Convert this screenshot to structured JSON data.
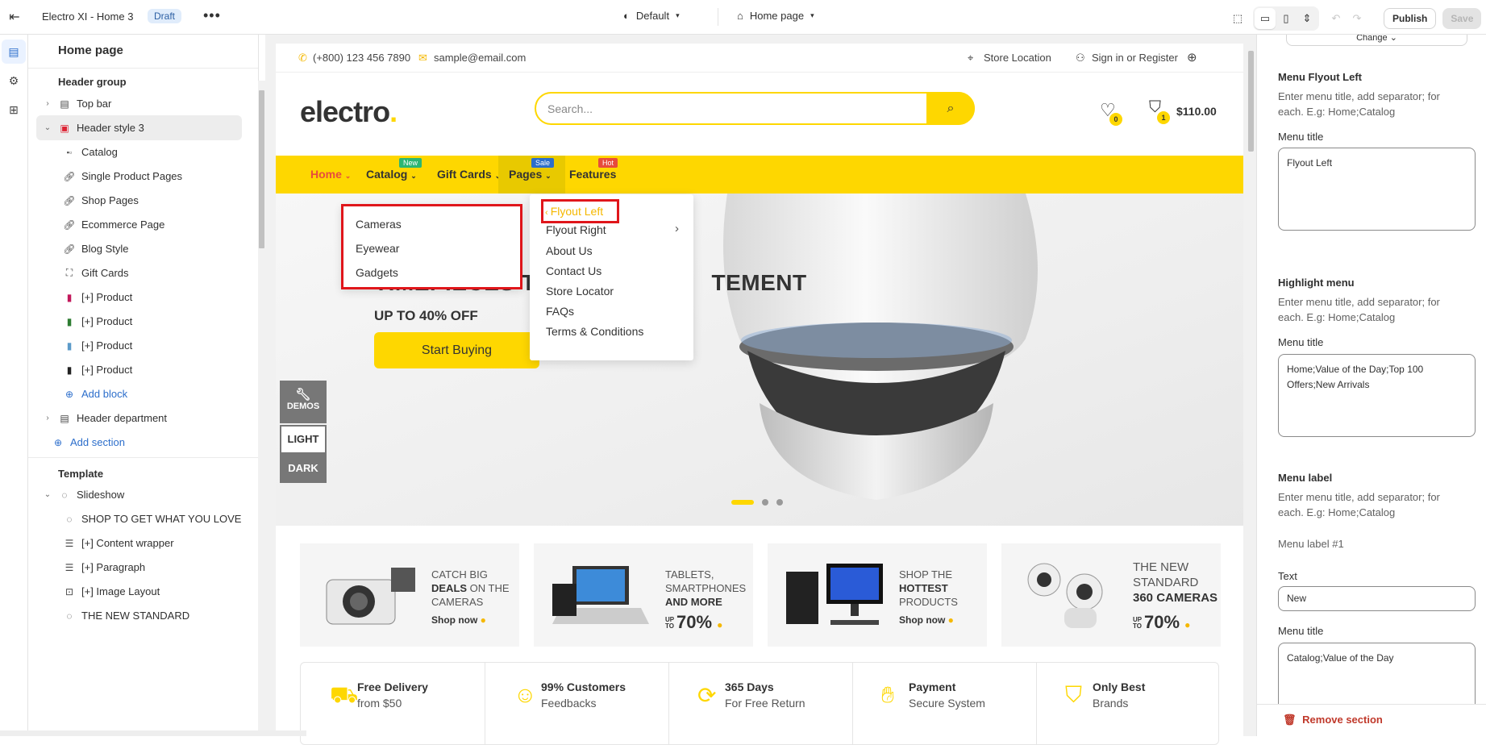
{
  "topbar": {
    "title": "Electro XI - Home 3",
    "draft": "Draft",
    "more": "•••",
    "theme": "Default",
    "page": "Home page",
    "publish": "Publish",
    "save": "Save"
  },
  "sidebar": {
    "title": "Home page",
    "header_group": "Header group",
    "items": [
      {
        "label": "Top bar"
      },
      {
        "label": "Header style 3"
      },
      {
        "label": "Catalog"
      },
      {
        "label": "Single Product Pages"
      },
      {
        "label": "Shop Pages"
      },
      {
        "label": "Ecommerce Page"
      },
      {
        "label": "Blog Style"
      },
      {
        "label": "Gift Cards"
      },
      {
        "label": "[+] Product"
      },
      {
        "label": "[+] Product"
      },
      {
        "label": "[+] Product"
      },
      {
        "label": "[+] Product"
      },
      {
        "label": "Add block"
      },
      {
        "label": "Header department"
      },
      {
        "label": "Add section"
      }
    ],
    "template": "Template",
    "template_items": [
      {
        "label": "Slideshow"
      },
      {
        "label": "SHOP TO GET WHAT YOU LOVE"
      },
      {
        "label": "[+] Content wrapper"
      },
      {
        "label": "[+] Paragraph"
      },
      {
        "label": "[+] Image Layout"
      },
      {
        "label": "THE NEW STANDARD"
      }
    ]
  },
  "store": {
    "phone": "(+800) 123 456 7890",
    "email": "sample@email.com",
    "store_location": "Store Location",
    "signin": "Sign in or Register",
    "logo": "electro",
    "logo_dot": ".",
    "search_placeholder": "Search...",
    "wishlist_count": "0",
    "cart_count": "1",
    "cart_total": "$110.00",
    "nav": [
      {
        "label": "Home",
        "tag": ""
      },
      {
        "label": "Catalog",
        "tag": "New"
      },
      {
        "label": "Gift Cards",
        "tag": ""
      },
      {
        "label": "Pages",
        "tag": "Sale"
      },
      {
        "label": "Features",
        "tag": "Hot"
      }
    ],
    "catalog_menu": [
      "Cameras",
      "Eyewear",
      "Gadgets"
    ],
    "pages_menu": {
      "flyout_left": "Flyout Left",
      "items": [
        "Flyout Right",
        "About Us",
        "Contact Us",
        "Store Locator",
        "FAQs",
        "Terms & Conditions"
      ]
    },
    "hero": {
      "headline_left": "TIMEPIECES T",
      "headline_right": "TEMENT",
      "sub": "UP TO 40% OFF",
      "button": "Start Buying"
    },
    "side": {
      "demos": "DEMOS",
      "light": "LIGHT",
      "dark": "DARK"
    },
    "promos": [
      {
        "l1": "CATCH BIG",
        "l2b": "DEALS",
        "l2": " ON THE",
        "l3": "CAMERAS",
        "cta": "Shop now"
      },
      {
        "l1": "TABLETS,",
        "l2": "SMARTPHONES",
        "l3b": "AND MORE",
        "up": "UP TO",
        "pct": "70%"
      },
      {
        "l1": "SHOP THE",
        "l2b": "HOTTEST",
        "l3": "PRODUCTS",
        "cta": "Shop now"
      },
      {
        "l1": "THE NEW",
        "l2": "STANDARD",
        "l3b": "360 CAMERAS",
        "up": "UP TO",
        "pct": "70%"
      }
    ],
    "features": [
      {
        "t1": "Free Delivery",
        "t2": "from $50"
      },
      {
        "t1": "99% Customers",
        "t2": "Feedbacks"
      },
      {
        "t1": "365 Days",
        "t2": "For Free Return"
      },
      {
        "t1": "Payment",
        "t2": "Secure System"
      },
      {
        "t1": "Only Best",
        "t2": "Brands"
      }
    ]
  },
  "rpanel": {
    "top_btn": "Change",
    "s1_title": "Menu Flyout Left",
    "s1_help": "Enter menu title, add separator; for each. E.g: Home;Catalog",
    "s1_label": "Menu title",
    "s1_value": "Flyout Left",
    "s2_title": "Highlight menu",
    "s2_help": "Enter menu title, add separator; for each. E.g: Home;Catalog",
    "s2_label": "Menu title",
    "s2_value": "Home;Value of the Day;Top 100 Offers;New Arrivals",
    "s3_title": "Menu label",
    "s3_help": "Enter menu title, add separator; for each. E.g: Home;Catalog",
    "s3_sub": "Menu label #1",
    "s3_text_label": "Text",
    "s3_text_value": "New",
    "s3_menu_label": "Menu title",
    "s3_menu_value": "Catalog;Value of the Day",
    "remove": "Remove section"
  },
  "colors": {
    "brand_yellow": "#fed700",
    "accent_red": "#e0161b",
    "shopify_blue": "#2c6ecb"
  }
}
